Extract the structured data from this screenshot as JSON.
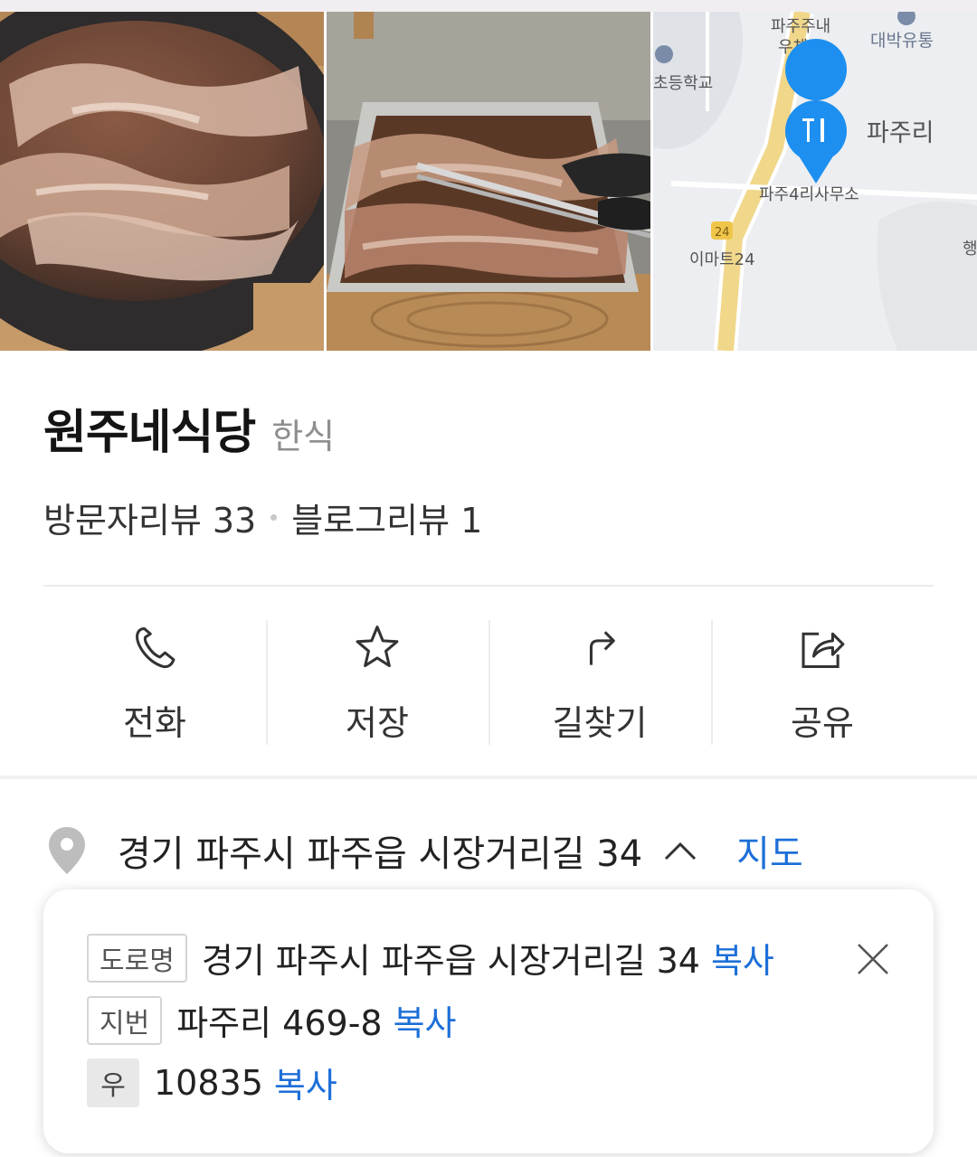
{
  "place": {
    "name": "원주네식당",
    "category": "한식",
    "visitor_reviews": "방문자리뷰 33",
    "blog_reviews": "블로그리뷰 1"
  },
  "photos": {
    "map_labels": {
      "post_office": "파주주내\n우체국",
      "store": "대박유통",
      "school": "초등학교",
      "village": "파주리",
      "office": "파주4리사무소",
      "mart": "이마트24",
      "route": "24"
    },
    "colors": {
      "pin": "#1d8ff0",
      "road": "#f0d78a"
    }
  },
  "actions": [
    {
      "label": "전화",
      "icon": "phone-icon"
    },
    {
      "label": "저장",
      "icon": "star-icon"
    },
    {
      "label": "길찾기",
      "icon": "directions-icon"
    },
    {
      "label": "공유",
      "icon": "share-icon"
    }
  ],
  "address": {
    "text": "경기 파주시 파주읍 시장거리길 34",
    "map_link": "지도"
  },
  "popup": {
    "road_tag": "도로명",
    "road_value": "경기 파주시 파주읍 시장거리길 34",
    "lot_tag": "지번",
    "lot_value": "파주리 469-8",
    "zip_tag": "우",
    "zip_value": "10835",
    "copy_label": "복사"
  },
  "colors": {
    "link": "#1d6fd8",
    "text": "#222222",
    "muted": "#8e8e8e"
  }
}
